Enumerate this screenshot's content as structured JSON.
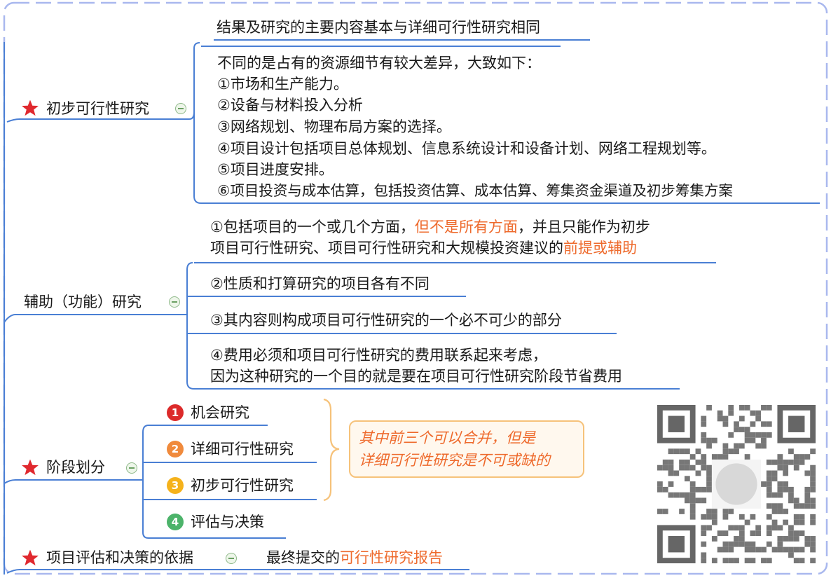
{
  "colors": {
    "accent_orange": "#ee6a2c",
    "line_blue": "#4a7fd4",
    "star_red": "#e0282e"
  },
  "topic1": {
    "label": "初步可行性研究",
    "children": {
      "line1": "结果及研究的主要内容基本与详细可行性研究相同",
      "detail": [
        "不同的是占有的资源细节有较大差异，大致如下：",
        "①市场和生产能力。",
        "②设备与材料投入分析",
        "③网络规划、物理布局方案的选择。",
        "④项目设计包括项目总体规划、信息系统设计和设备计划、网络工程规划等。",
        "⑤项目进度安排。",
        "⑥项目投资与成本估算，包括投资估算、成本估算、筹集资金渠道及初步筹集方案"
      ]
    }
  },
  "topic2": {
    "label": "辅助（功能）研究",
    "item1": {
      "a": "①包括项目的一个或几个方面，",
      "b": "但不是所有方面",
      "c": "，并且只能作为初步",
      "d": "项目可行性研究、项目可行性研究和大规模投资建议的",
      "e": "前提或辅助"
    },
    "item2": "②性质和打算研究的项目各有不同",
    "item3": "③其内容则构成项目可行性研究的一个必不可少的部分",
    "item4": [
      "④费用必须和项目可行性研究的费用联系起来考虑，",
      "因为这种研究的一个目的就是要在项目可行性研究阶段节省费用"
    ]
  },
  "topic3": {
    "label": "阶段划分",
    "stages": [
      {
        "num": "1",
        "label": "机会研究",
        "color": "#dc2a2a"
      },
      {
        "num": "2",
        "label": "详细可行性研究",
        "color": "#f08a3c"
      },
      {
        "num": "3",
        "label": "初步可行性研究",
        "color": "#f5b21b"
      },
      {
        "num": "4",
        "label": "评估与决策",
        "color": "#4cb36a"
      }
    ],
    "note": [
      "其中前三个可以合并，但是",
      "详细可行性研究是不可或缺的"
    ]
  },
  "topic4": {
    "label": "项目评估和决策的依据",
    "a": "最终提交的",
    "b": "可行性研究报告"
  }
}
